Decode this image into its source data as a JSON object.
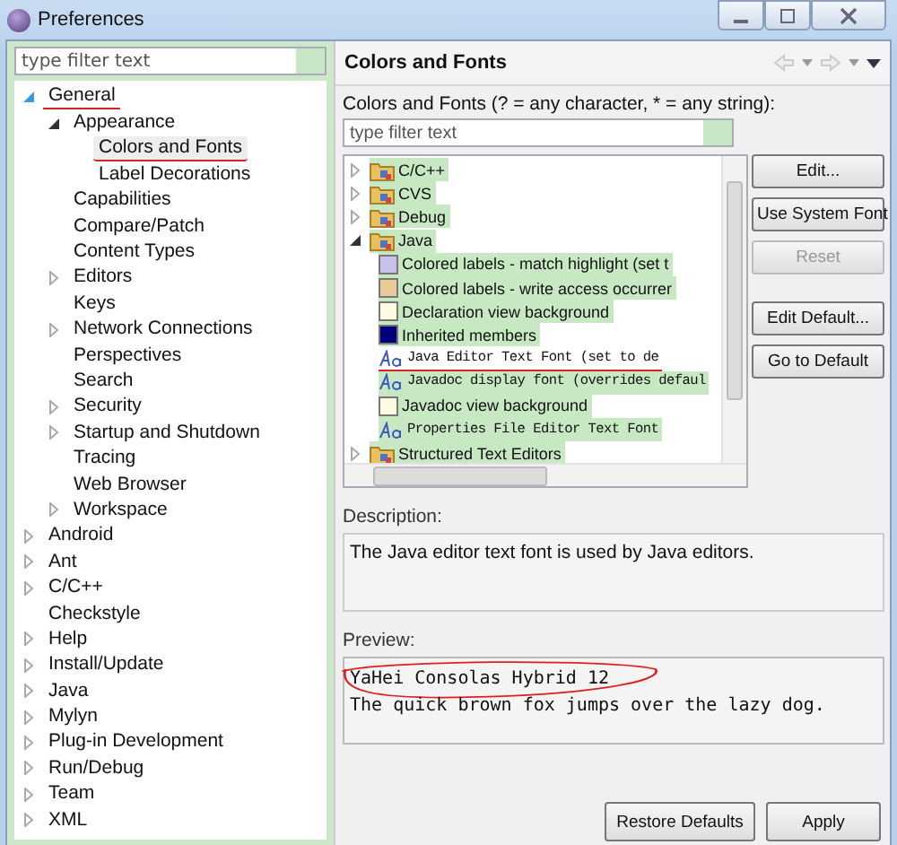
{
  "window": {
    "title": "Preferences"
  },
  "sidebar": {
    "filter": {
      "placeholder": "type filter text"
    },
    "items": [
      {
        "label": "General",
        "expanded": true,
        "selected": false,
        "marked": true,
        "children": [
          {
            "label": "Appearance",
            "expanded": true,
            "selected": false,
            "marked": false,
            "children": [
              {
                "label": "Colors and Fonts",
                "selected": true,
                "marked": true
              },
              {
                "label": "Label Decorations",
                "selected": false,
                "marked": false
              }
            ]
          },
          {
            "label": "Capabilities",
            "selected": false,
            "marked": false
          },
          {
            "label": "Compare/Patch",
            "selected": false,
            "marked": false
          },
          {
            "label": "Content Types",
            "selected": false,
            "marked": false
          },
          {
            "label": "Editors",
            "expanded": false,
            "selected": false,
            "marked": false
          },
          {
            "label": "Keys",
            "selected": false,
            "marked": false
          },
          {
            "label": "Network Connections",
            "expanded": false,
            "selected": false,
            "marked": false
          },
          {
            "label": "Perspectives",
            "selected": false,
            "marked": false
          },
          {
            "label": "Search",
            "selected": false,
            "marked": false
          },
          {
            "label": "Security",
            "expanded": false,
            "selected": false,
            "marked": false
          },
          {
            "label": "Startup and Shutdown",
            "expanded": false,
            "selected": false,
            "marked": false
          },
          {
            "label": "Tracing",
            "selected": false,
            "marked": false
          },
          {
            "label": "Web Browser",
            "selected": false,
            "marked": false
          },
          {
            "label": "Workspace",
            "expanded": false,
            "selected": false,
            "marked": false
          }
        ]
      },
      {
        "label": "Android",
        "expanded": false,
        "selected": false,
        "marked": false
      },
      {
        "label": "Ant",
        "expanded": false,
        "selected": false,
        "marked": false
      },
      {
        "label": "C/C++",
        "expanded": false,
        "selected": false,
        "marked": false
      },
      {
        "label": "Checkstyle",
        "selected": false,
        "marked": false
      },
      {
        "label": "Help",
        "expanded": false,
        "selected": false,
        "marked": false
      },
      {
        "label": "Install/Update",
        "expanded": false,
        "selected": false,
        "marked": false
      },
      {
        "label": "Java",
        "expanded": false,
        "selected": false,
        "marked": false
      },
      {
        "label": "Mylyn",
        "expanded": false,
        "selected": false,
        "marked": false
      },
      {
        "label": "Plug-in Development",
        "expanded": false,
        "selected": false,
        "marked": false
      },
      {
        "label": "Run/Debug",
        "expanded": false,
        "selected": false,
        "marked": false
      },
      {
        "label": "Team",
        "expanded": false,
        "selected": false,
        "marked": false
      },
      {
        "label": "XML",
        "expanded": false,
        "selected": false,
        "marked": false
      }
    ]
  },
  "page": {
    "title": "Colors and Fonts",
    "filter_label": "Colors and Fonts (? = any character, * = any string):",
    "filter": {
      "placeholder": "type filter text"
    },
    "items": [
      {
        "kind": "folder",
        "label": "C/C++",
        "expanded": false,
        "highlighted": true,
        "marked": false
      },
      {
        "kind": "folder",
        "label": "CVS",
        "expanded": false,
        "highlighted": true,
        "marked": false
      },
      {
        "kind": "folder",
        "label": "Debug",
        "expanded": false,
        "highlighted": true,
        "marked": false
      },
      {
        "kind": "folder",
        "label": "Java",
        "expanded": true,
        "highlighted": true,
        "marked": false,
        "children": [
          {
            "kind": "color",
            "label": "Colored labels - match highlight (set t",
            "color": "#c8c2ea",
            "highlighted": true,
            "marked": false
          },
          {
            "kind": "color",
            "label": "Colored labels - write access occurrer",
            "color": "#e8cc98",
            "highlighted": true,
            "marked": false
          },
          {
            "kind": "color",
            "label": "Declaration view background",
            "color": "#fffbe0",
            "highlighted": true,
            "marked": false
          },
          {
            "kind": "color",
            "label": "Inherited members",
            "color": "#00007a",
            "highlighted": true,
            "marked": false
          },
          {
            "kind": "font",
            "label": "Java Editor Text Font (set to de",
            "highlighted": false,
            "marked": true
          },
          {
            "kind": "font",
            "label": "Javadoc display font (overrides defaul",
            "highlighted": true,
            "marked": false
          },
          {
            "kind": "color",
            "label": "Javadoc view background",
            "color": "#fffbe0",
            "highlighted": true,
            "marked": false
          },
          {
            "kind": "font",
            "label": "Properties File Editor Text Font",
            "highlighted": true,
            "marked": false
          }
        ]
      },
      {
        "kind": "folder",
        "label": "Structured Text Editors",
        "expanded": false,
        "highlighted": true,
        "marked": false
      }
    ],
    "side_buttons": [
      {
        "label": "Edit...",
        "disabled": false
      },
      {
        "label": "Use System Font",
        "disabled": false
      },
      {
        "label": "Reset",
        "disabled": true
      },
      {
        "label": "Edit Default...",
        "disabled": false
      },
      {
        "label": "Go to Default",
        "disabled": false
      }
    ],
    "description_label": "Description:",
    "description": "The Java editor text font is used by Java editors.",
    "preview_label": "Preview:",
    "preview_lines": [
      {
        "text": "YaHei Consolas Hybrid 12",
        "circled": true
      },
      {
        "text": "The quick brown fox jumps over the lazy dog.",
        "circled": false
      }
    ],
    "buttons": [
      "Restore Defaults",
      "Apply"
    ]
  }
}
